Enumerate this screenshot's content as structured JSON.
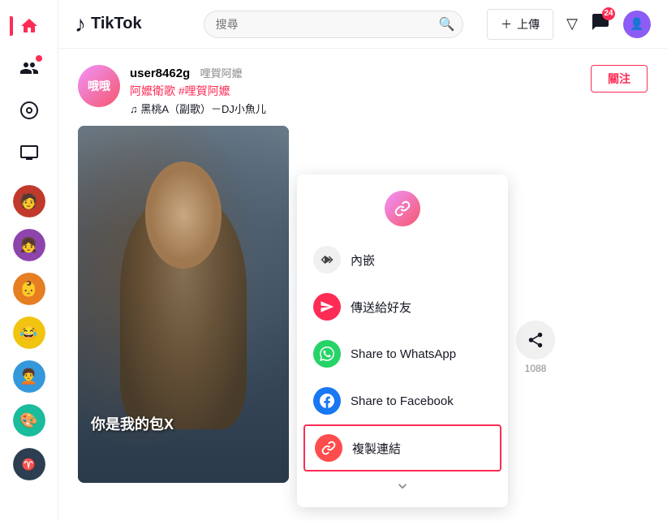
{
  "app": {
    "title": "TikTok",
    "logo_text": "TikTok"
  },
  "topnav": {
    "search_placeholder": "搜尋",
    "upload_label": "上傳",
    "notification_count": "24"
  },
  "sidebar": {
    "items": [
      {
        "id": "home",
        "icon": "🏠",
        "active": true
      },
      {
        "id": "friends",
        "icon": "👥",
        "active": false
      },
      {
        "id": "explore",
        "icon": "⊙",
        "active": false
      },
      {
        "id": "live",
        "icon": "📺",
        "active": false
      }
    ],
    "avatars": [
      {
        "id": "avatar1",
        "emoji": "🧑",
        "bg": "#c0392b"
      },
      {
        "id": "avatar2",
        "emoji": "👧",
        "bg": "#8e44ad"
      },
      {
        "id": "avatar3",
        "emoji": "👶",
        "bg": "#e67e22"
      },
      {
        "id": "avatar4",
        "emoji": "😂",
        "bg": "#f1c40f"
      },
      {
        "id": "avatar5",
        "emoji": "🧑‍🦱",
        "bg": "#3498db"
      },
      {
        "id": "avatar6",
        "emoji": "🎨",
        "bg": "#1abc9c"
      },
      {
        "id": "avatar7",
        "emoji": "♈",
        "bg": "#2c3e50"
      }
    ]
  },
  "post": {
    "username": "user8462g",
    "display_name": "哩賀阿嬤",
    "caption": "阿嬤衛歌 #哩賀阿嬤",
    "music": "♫ 黑桃A（副歌）－DJ小魚儿",
    "follow_label": "關注",
    "video_overlay_text": "你是我的包X"
  },
  "share_panel": {
    "items": [
      {
        "id": "embed",
        "icon_type": "embed",
        "label": "內嵌"
      },
      {
        "id": "send",
        "icon_type": "send",
        "label": "傳送給好友"
      },
      {
        "id": "whatsapp",
        "icon_type": "whatsapp",
        "label": "Share to WhatsApp"
      },
      {
        "id": "facebook",
        "icon_type": "facebook",
        "label": "Share to Facebook"
      },
      {
        "id": "copylink",
        "icon_type": "link",
        "label": "複製連結",
        "highlighted": true
      }
    ],
    "more_icon": "∨"
  },
  "actions": {
    "share_count": "1088",
    "share_icon": "↪"
  }
}
